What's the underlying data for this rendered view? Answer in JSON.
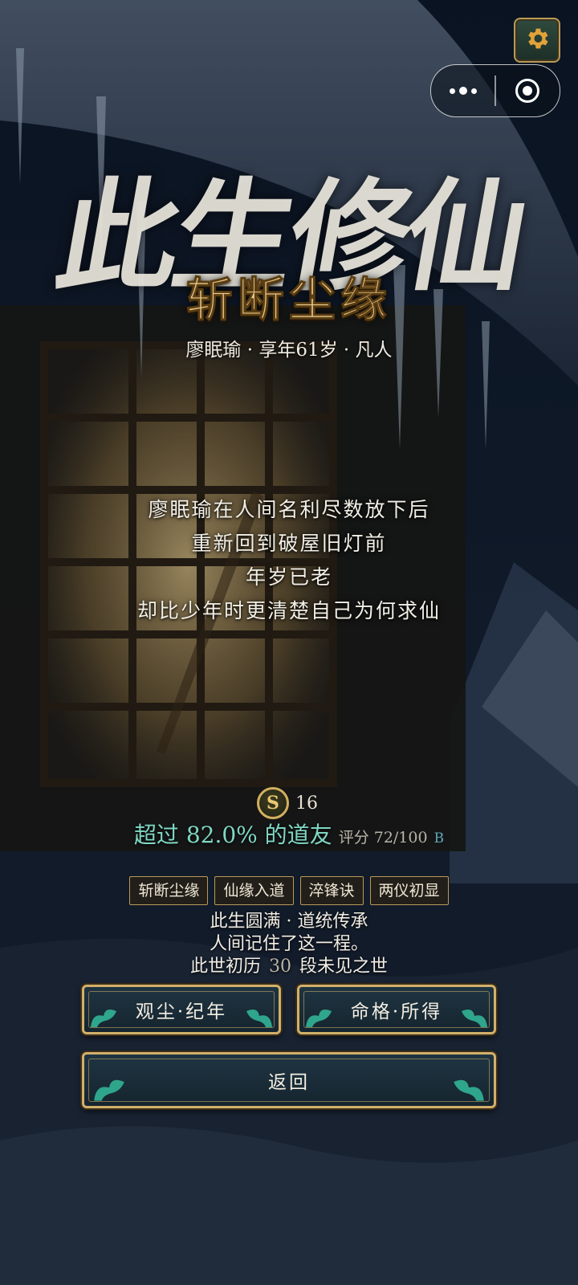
{
  "header": {
    "settings_icon": "gear-icon",
    "capsule": {
      "more_icon": "more-dots-icon",
      "close_icon": "target-ring-icon"
    }
  },
  "title": {
    "calligraphy": "此生修仙",
    "subtitle": "斩断尘缘"
  },
  "character": {
    "info": "廖眠瑜 · 享年61岁 · 凡人"
  },
  "story": {
    "lines": [
      "廖眠瑜在人间名利尽数放下后",
      "重新回到破屋旧灯前",
      "年岁已老",
      "却比少年时更清楚自己为何求仙"
    ]
  },
  "score": {
    "coin_icon": "dao-coin-icon",
    "coin_count": "16",
    "rank_text": "超过 82.0% 的道友",
    "rating_text": "评分 72/100",
    "grade": "B"
  },
  "tags": [
    "斩断尘缘",
    "仙缘入道",
    "淬锋诀",
    "两仪初显"
  ],
  "summary": {
    "line1": "此生圆满 · 道统传承",
    "line2": "人间记住了这一程。",
    "line3_prefix": "此世初历",
    "line3_count": "30",
    "line3_suffix": "段未见之世"
  },
  "buttons": {
    "chronicle": "观尘·纪年",
    "gains": "命格·所得",
    "back": "返回"
  },
  "colors": {
    "gold": "#d2b06a",
    "teal_text": "#7fd7c3",
    "subtitle_gold": "#e9c98b",
    "button_bg": "#1f3442"
  }
}
